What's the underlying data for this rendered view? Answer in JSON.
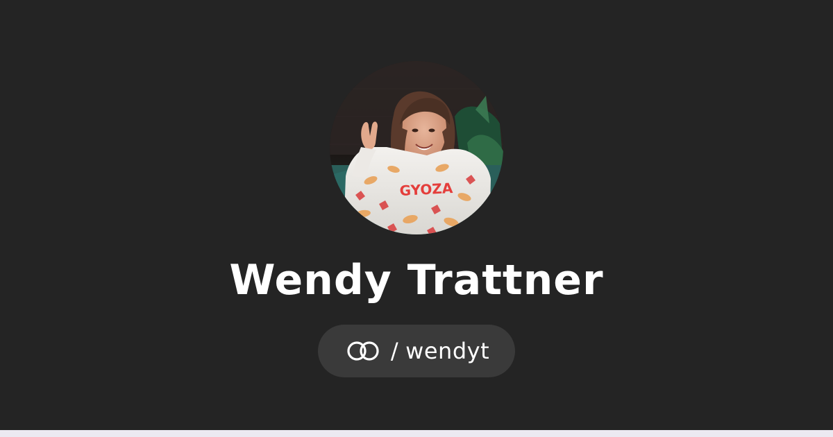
{
  "profile": {
    "name": "Wendy Trattner",
    "avatar": {
      "icon": "profile-photo"
    }
  },
  "handle": {
    "logo_icon": "linked-rings-icon",
    "separator": "/",
    "username": "wendyt"
  },
  "colors": {
    "background": "#242424",
    "pill": "#3a3a3a",
    "text": "#ffffff",
    "bottom_strip": "#ece9f1"
  }
}
